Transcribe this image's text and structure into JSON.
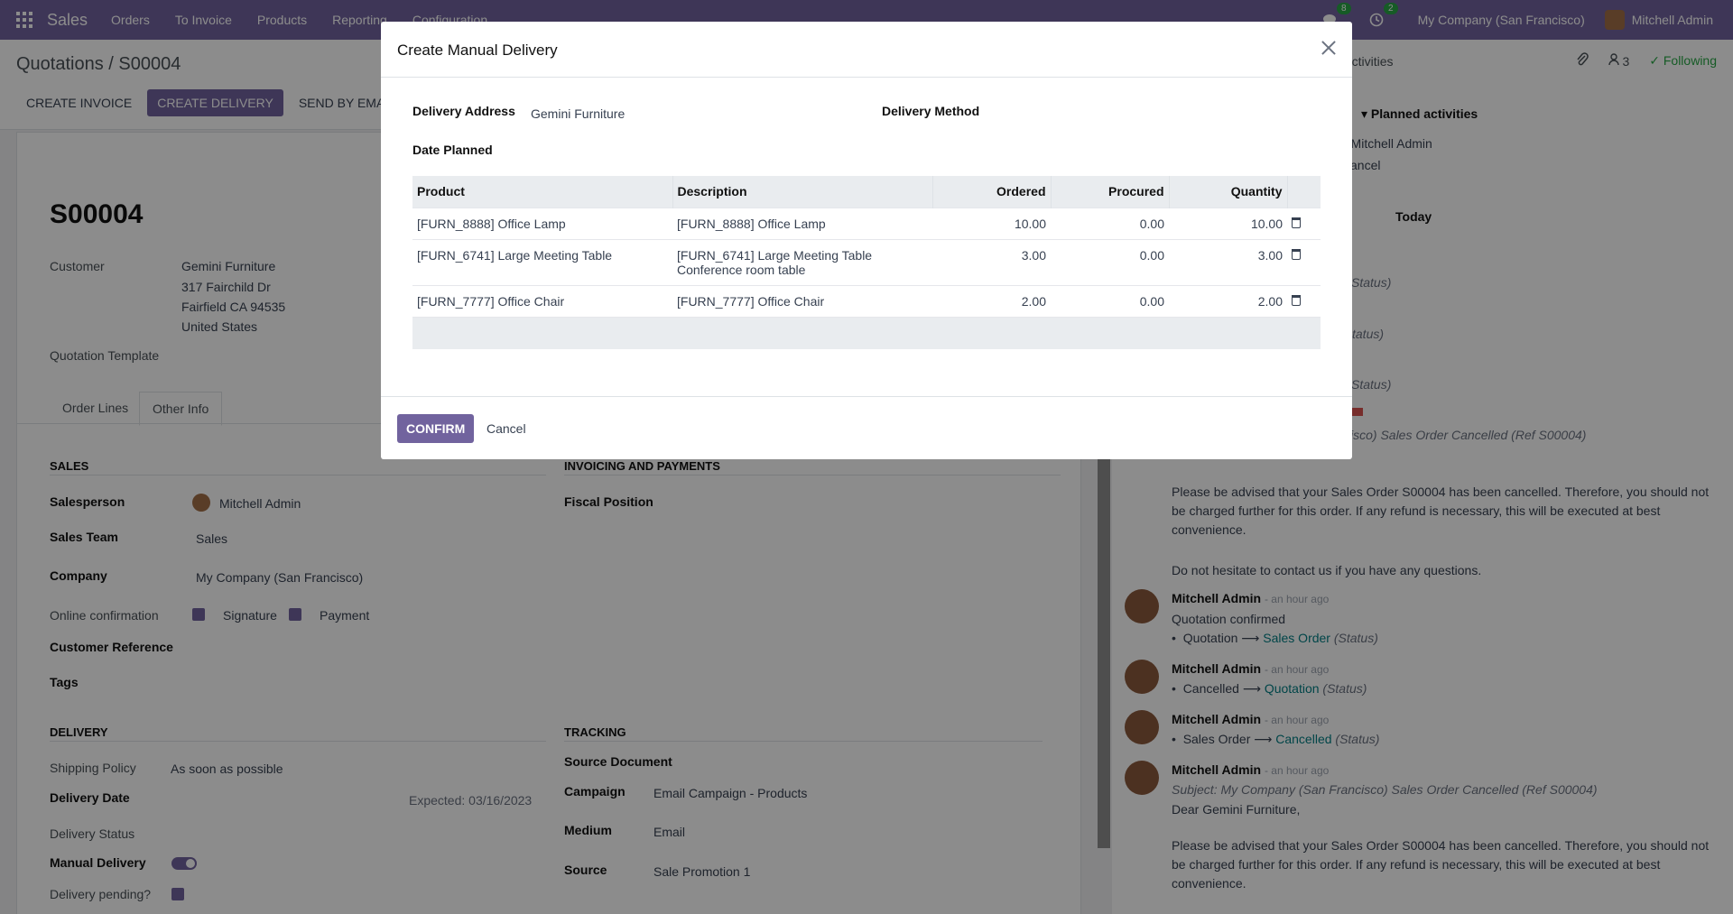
{
  "navbar": {
    "brand": "Sales",
    "menu": [
      "Orders",
      "To Invoice",
      "Products",
      "Reporting",
      "Configuration"
    ],
    "messages_count": "8",
    "activities_count": "2",
    "company": "My Company (San Francisco)",
    "user": "Mitchell Admin"
  },
  "control": {
    "breadcrumb": "Quotations / S00004",
    "actions": [
      "CREATE INVOICE",
      "CREATE DELIVERY",
      "SEND BY EMAIL"
    ],
    "activities_fragment": "ctivities",
    "followers_count": "3",
    "following": "Following"
  },
  "form": {
    "title": "S00004",
    "customer_label": "Customer",
    "customer_lines": [
      "Gemini Furniture",
      "317 Fairchild Dr",
      "Fairfield CA 94535",
      "United States"
    ],
    "quotation_template_label": "Quotation Template",
    "tabs": [
      "Order Lines",
      "Other Info"
    ],
    "sales_section": "SALES",
    "invoicing_section": "INVOICING AND PAYMENTS",
    "salesperson_label": "Salesperson",
    "salesperson": "Mitchell Admin",
    "sales_team_label": "Sales Team",
    "sales_team": "Sales",
    "company_label": "Company",
    "company": "My Company (San Francisco)",
    "online_confirmation_label": "Online confirmation",
    "signature": "Signature",
    "payment": "Payment",
    "customer_reference_label": "Customer Reference",
    "tags_label": "Tags",
    "fiscal_position_label": "Fiscal Position",
    "delivery_section": "DELIVERY",
    "tracking_section": "TRACKING",
    "shipping_policy_label": "Shipping Policy",
    "shipping_policy": "As soon as possible",
    "delivery_date_label": "Delivery Date",
    "expected": "Expected: 03/16/2023",
    "delivery_status_label": "Delivery Status",
    "manual_delivery_label": "Manual Delivery",
    "delivery_pending_label": "Delivery pending?",
    "source_document_label": "Source Document",
    "campaign_label": "Campaign",
    "campaign": "Email Campaign - Products",
    "medium_label": "Medium",
    "medium": "Email",
    "source_label": "Source",
    "source": "Sale Promotion 1"
  },
  "chatter": {
    "planned_activities": "Planned activities",
    "activity_user": "r Mitchell Admin",
    "activity_cancel": "ancel",
    "today": "Today",
    "status_fragments": [
      "Status)",
      "tatus)",
      "Status)"
    ],
    "cancelled_subject_fragment": "isco) Sales Order Cancelled (Ref S00004)",
    "advised_1": "Please be advised that your Sales Order S00004 has been cancelled. Therefore, you should not be charged further for this order. If any refund is necessary, this will be executed at best convenience.",
    "no_hesitate": "Do not hesitate to contact us if you have any questions.",
    "messages": [
      {
        "author": "Mitchell Admin",
        "time": "- an hour ago",
        "line1": "Quotation confirmed",
        "bullet_from": "Quotation",
        "bullet_to": "Sales Order",
        "status": "(Status)"
      },
      {
        "author": "Mitchell Admin",
        "time": "- an hour ago",
        "bullet_from": "Cancelled",
        "bullet_to": "Quotation",
        "status": "(Status)"
      },
      {
        "author": "Mitchell Admin",
        "time": "- an hour ago",
        "bullet_from": "Sales Order",
        "bullet_to": "Cancelled",
        "status": "(Status)"
      },
      {
        "author": "Mitchell Admin",
        "time": "- an hour ago",
        "subject": "Subject: My Company (San Francisco) Sales Order Cancelled (Ref S00004)",
        "greeting": "Dear Gemini Furniture,"
      }
    ],
    "advised_2": "Please be advised that your Sales Order S00004 has been cancelled. Therefore, you should not be charged further for this order. If any refund is necessary, this will be executed at best convenience."
  },
  "modal": {
    "title": "Create Manual Delivery",
    "delivery_address_label": "Delivery Address",
    "delivery_address": "Gemini Furniture",
    "delivery_method_label": "Delivery Method",
    "date_planned_label": "Date Planned",
    "columns": [
      "Product",
      "Description",
      "Ordered",
      "Procured",
      "Quantity"
    ],
    "rows": [
      {
        "product": "[FURN_8888] Office Lamp",
        "description": "[FURN_8888] Office Lamp",
        "description2": "",
        "ordered": "10.00",
        "procured": "0.00",
        "quantity": "10.00"
      },
      {
        "product": "[FURN_6741] Large Meeting Table",
        "description": "[FURN_6741] Large Meeting Table",
        "description2": "Conference room table",
        "ordered": "3.00",
        "procured": "0.00",
        "quantity": "3.00"
      },
      {
        "product": "[FURN_7777] Office Chair",
        "description": "[FURN_7777] Office Chair",
        "description2": "",
        "ordered": "2.00",
        "procured": "0.00",
        "quantity": "2.00"
      }
    ],
    "confirm": "CONFIRM",
    "cancel": "Cancel"
  },
  "colors": {
    "primary": "#71639e",
    "success": "#28a745",
    "link": "#017e84"
  }
}
